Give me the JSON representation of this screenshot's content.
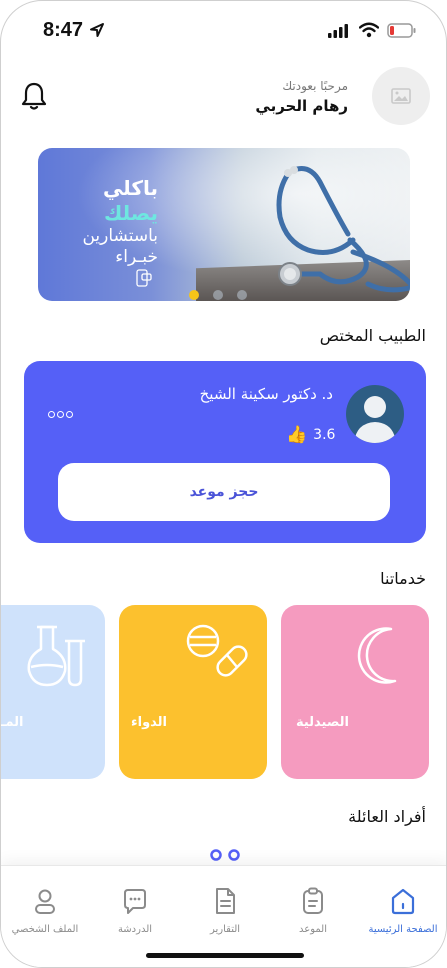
{
  "status_bar": {
    "time": "8:47",
    "icons": [
      "location-arrow-icon",
      "cellular-signal-icon",
      "wifi-icon",
      "battery-low-icon"
    ],
    "battery_color": "#e53935"
  },
  "header": {
    "greeting": "مرحبًا بعودتك",
    "user_name": "رهام الحربي",
    "icons": [
      "bell-icon",
      "image-placeholder-icon"
    ]
  },
  "banner": {
    "line1": "باكلي",
    "line2": "يصلك",
    "line3": "باستشارين",
    "line4": "خبـراء",
    "slides_count": 3,
    "active_slide": 1,
    "indicator_color": "#f5c518"
  },
  "specialist": {
    "section_title": "الطبيب المختص",
    "doctor_name": "د. دكتور سكينة الشيخ",
    "rating": "3.6",
    "book_button": "حجز موعد",
    "card_color": "#5560f7"
  },
  "services": {
    "section_title": "خدماتنا",
    "items": [
      {
        "label": "الصيدلية",
        "icon": "crescent-moon-icon",
        "color": "#f59bbf"
      },
      {
        "label": "الدواء",
        "icon": "pills-icon",
        "color": "#fcc12e"
      },
      {
        "label": "المـ",
        "icon": "lab-flask-icon",
        "color": "#cfe2fb"
      }
    ]
  },
  "family": {
    "section_title": "أفراد العائلة"
  },
  "bottom_nav": {
    "items": [
      {
        "label": "الصفحة الرئيسية",
        "icon": "home-icon",
        "active": true
      },
      {
        "label": "الموعد",
        "icon": "clipboard-icon",
        "active": false
      },
      {
        "label": "التقارير",
        "icon": "document-icon",
        "active": false
      },
      {
        "label": "الدردشة",
        "icon": "chat-icon",
        "active": false
      },
      {
        "label": "الملف الشخصي",
        "icon": "user-icon",
        "active": false
      }
    ],
    "active_color": "#3b6fd9"
  }
}
